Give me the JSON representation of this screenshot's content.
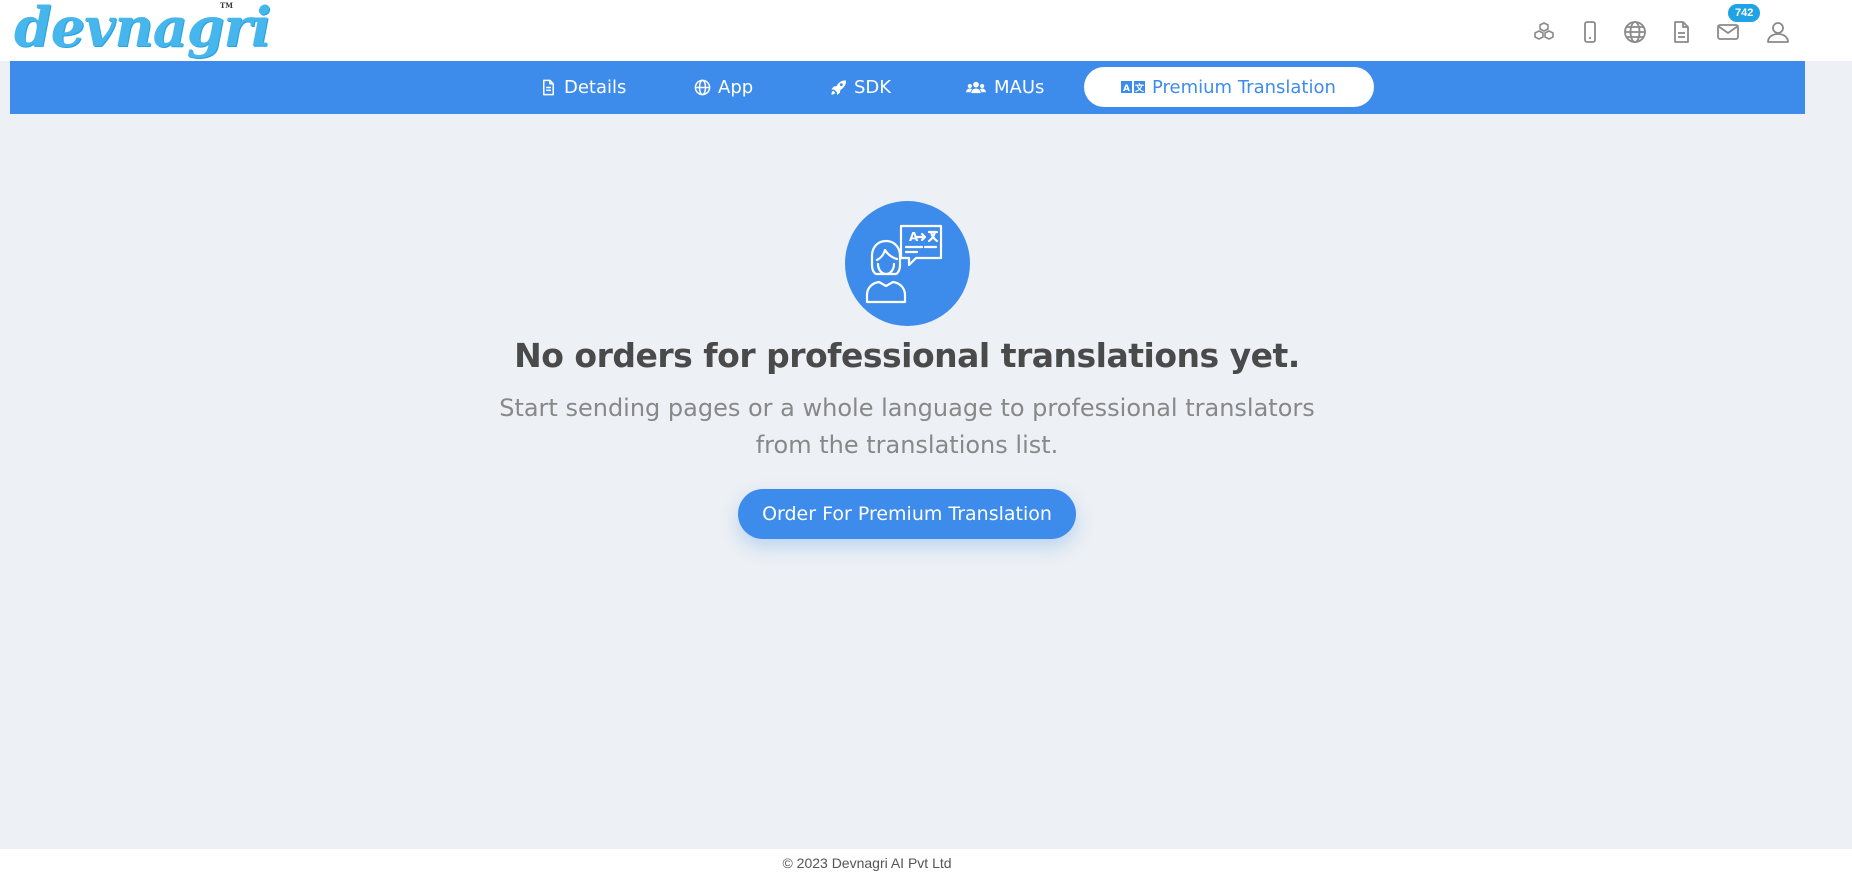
{
  "brand": {
    "logo_text": "devnagri",
    "trademark": "TM"
  },
  "header": {
    "icons": [
      "cubes-icon",
      "mobile-icon",
      "globe-icon",
      "document-icon",
      "mail-icon",
      "user-icon"
    ],
    "mail_badge": "742"
  },
  "tabs": [
    {
      "label": "Details",
      "icon": "file-icon"
    },
    {
      "label": "App",
      "icon": "globe-icon"
    },
    {
      "label": "SDK",
      "icon": "rocket-icon"
    },
    {
      "label": "MAUs",
      "icon": "users-icon"
    },
    {
      "label": "Premium Translation",
      "icon": "translate-icon",
      "active": true
    }
  ],
  "empty_state": {
    "icon": "translator-icon",
    "title": "No orders for professional translations yet.",
    "description": "Start sending pages or a whole language to professional translators from the translations list.",
    "cta_label": "Order For Premium Translation"
  },
  "footer": {
    "copyright": "© 2023 Devnagri AI Pvt Ltd"
  },
  "colors": {
    "accent": "#3d8bea",
    "background": "#edf0f4",
    "badge": "#1fa3e4"
  }
}
